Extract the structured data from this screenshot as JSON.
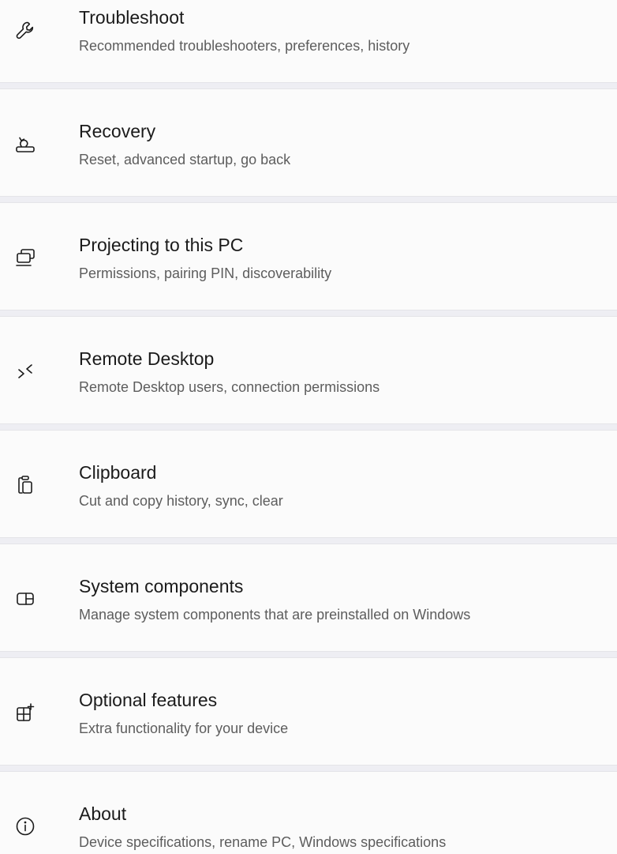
{
  "settings_list": {
    "items": [
      {
        "title": "Troubleshoot",
        "description": "Recommended troubleshooters, preferences, history",
        "icon": "wrench-icon"
      },
      {
        "title": "Recovery",
        "description": "Reset, advanced startup, go back",
        "icon": "recovery-icon"
      },
      {
        "title": "Projecting to this PC",
        "description": "Permissions, pairing PIN, discoverability",
        "icon": "projecting-icon"
      },
      {
        "title": "Remote Desktop",
        "description": "Remote Desktop users, connection permissions",
        "icon": "remote-desktop-icon"
      },
      {
        "title": "Clipboard",
        "description": "Cut and copy history, sync, clear",
        "icon": "clipboard-icon"
      },
      {
        "title": "System components",
        "description": "Manage system components that are preinstalled on Windows",
        "icon": "system-components-icon"
      },
      {
        "title": "Optional features",
        "description": "Extra functionality for your device",
        "icon": "optional-features-icon"
      },
      {
        "title": "About",
        "description": "Device specifications, rename PC, Windows specifications",
        "icon": "info-icon"
      }
    ]
  }
}
